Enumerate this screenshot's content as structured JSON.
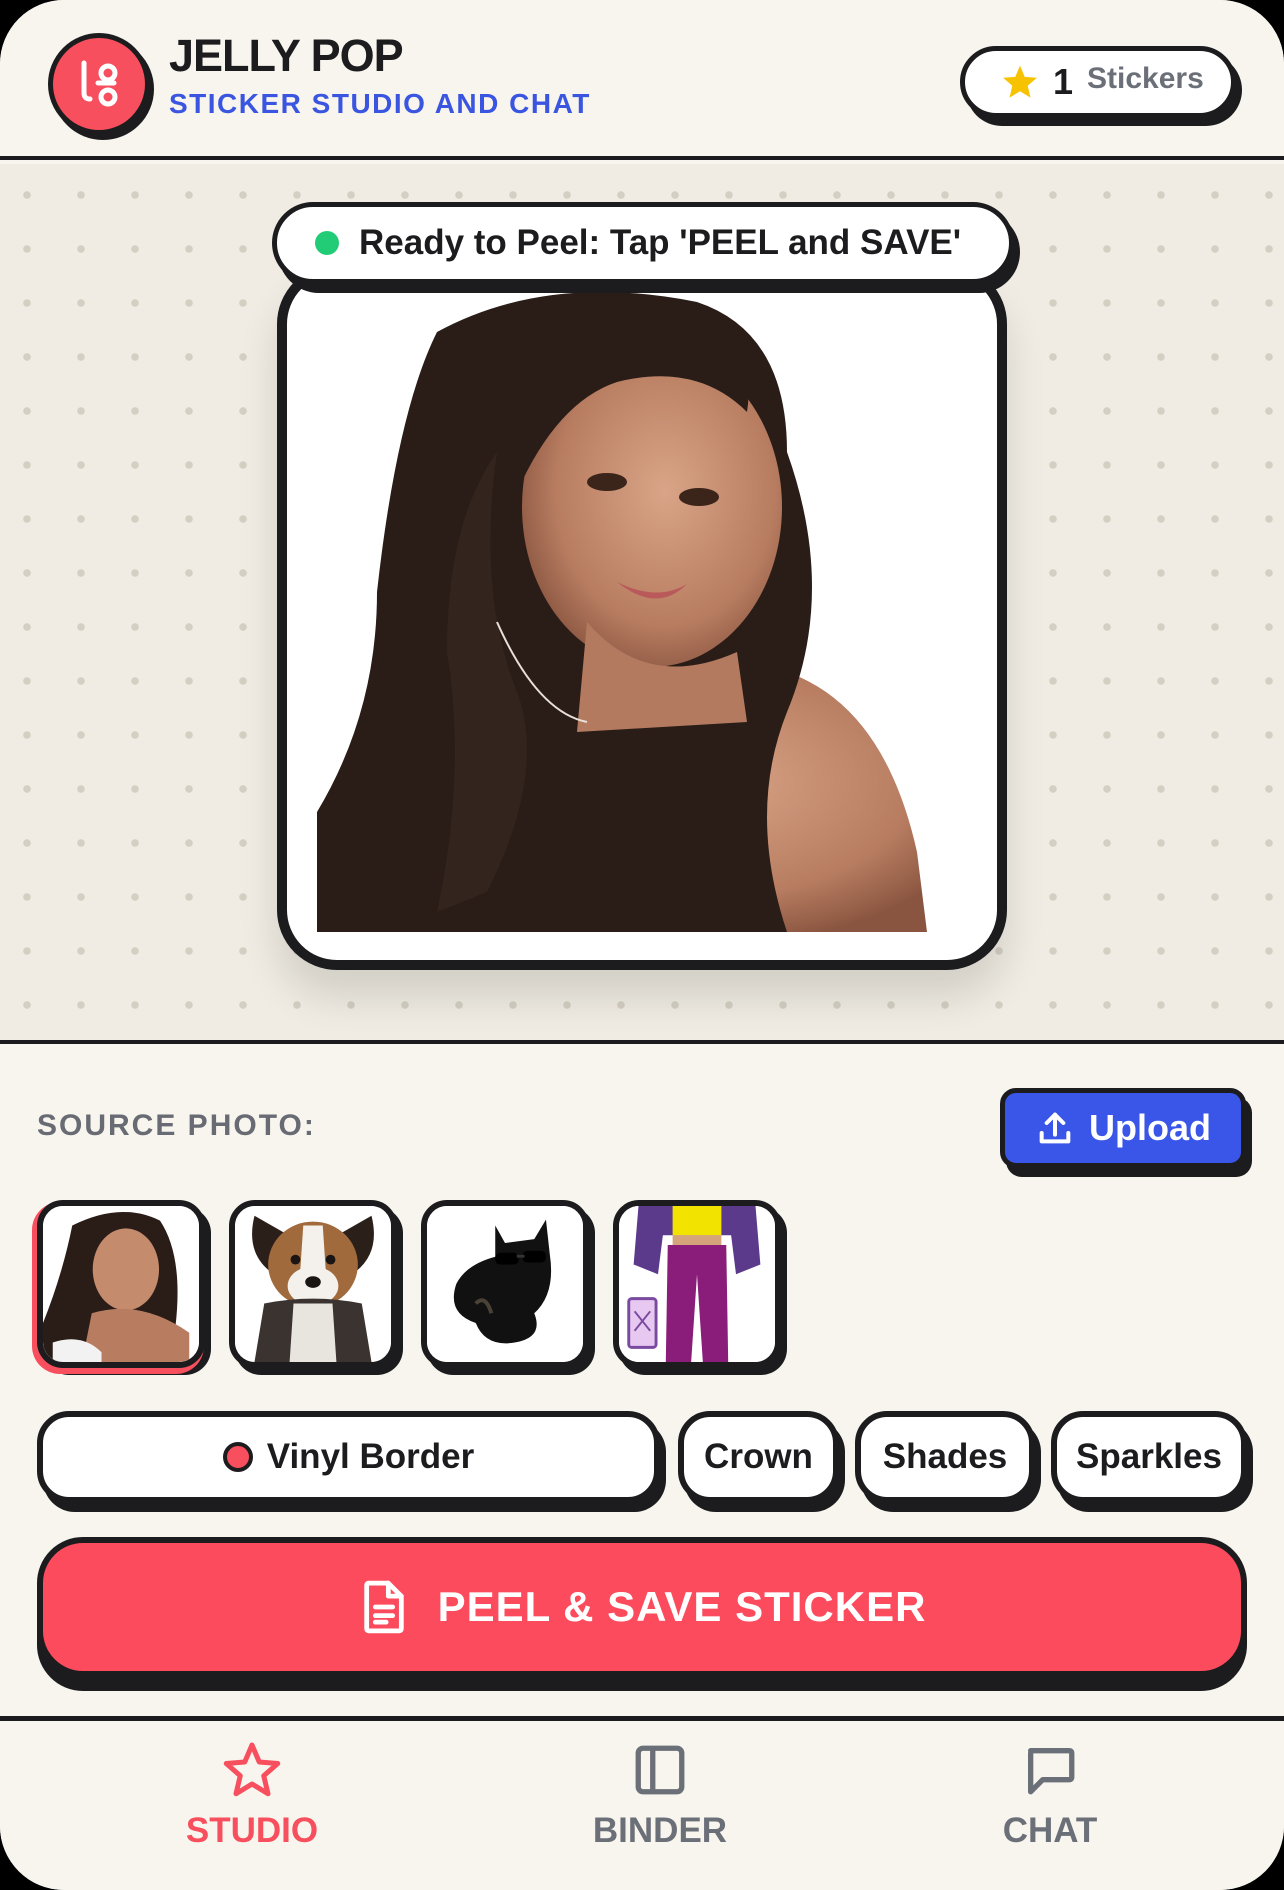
{
  "header": {
    "app_title": "JELLY POP",
    "app_subtitle": "STICKER STUDIO AND CHAT",
    "sticker_count": "1",
    "sticker_count_label": "Stickers",
    "logo_icon": "link-icon",
    "count_icon": "star-icon"
  },
  "canvas": {
    "status_text": "Ready to Peel: Tap 'PEEL and SAVE'",
    "status_color": "#22cc77"
  },
  "source": {
    "label": "SOURCE PHOTO:",
    "upload_label": "Upload",
    "thumbnails": [
      {
        "name": "woman-portrait",
        "selected": true
      },
      {
        "name": "puppy",
        "selected": false
      },
      {
        "name": "black-cat-sunglasses",
        "selected": false
      },
      {
        "name": "retro-outfit-person",
        "selected": false
      }
    ]
  },
  "styles": {
    "chips": [
      "Vinyl Border",
      "Crown",
      "Shades",
      "Sparkles"
    ],
    "active_chip": "Vinyl Border"
  },
  "actions": {
    "peel_label": "PEEL & SAVE STICKER"
  },
  "nav": {
    "items": [
      {
        "label": "STUDIO",
        "icon": "star-icon",
        "active": true
      },
      {
        "label": "BINDER",
        "icon": "binder-icon",
        "active": false
      },
      {
        "label": "CHAT",
        "icon": "chat-icon",
        "active": false
      }
    ]
  },
  "colors": {
    "accent": "#f74f5d",
    "primary_blue": "#3a56e8",
    "ink": "#1c1c1f",
    "background": "#f8f5ee"
  }
}
